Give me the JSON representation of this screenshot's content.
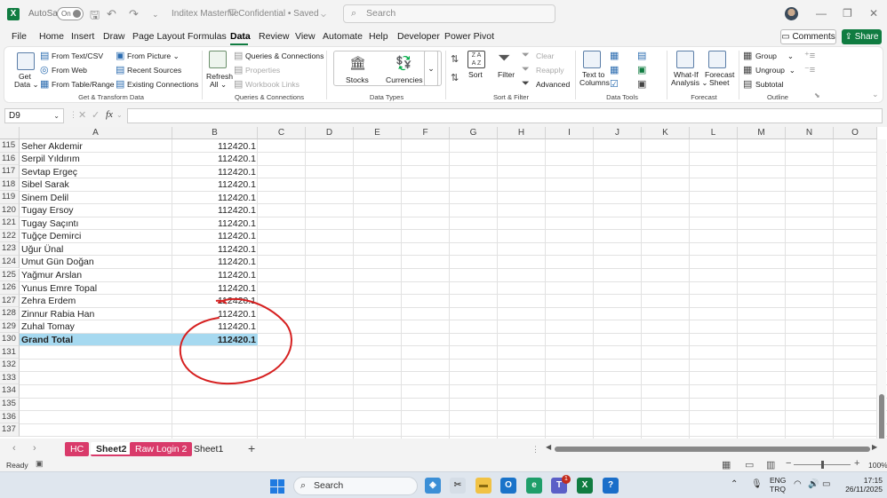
{
  "titlebar": {
    "autosave_label": "AutoSave",
    "autosave_state": "On",
    "doc_title": "Inditex Masterfile",
    "sensitivity": "Confidential",
    "save_state": "Saved",
    "search_placeholder": "Search"
  },
  "menu": [
    "File",
    "Home",
    "Insert",
    "Draw",
    "Page Layout",
    "Formulas",
    "Data",
    "Review",
    "View",
    "Automate",
    "Help",
    "Developer",
    "Power Pivot"
  ],
  "menu_active": "Data",
  "comments_label": "Comments",
  "share_label": "Share",
  "ribbon": {
    "get_data": "Get Data",
    "get_data_line1": "Get",
    "get_data_line2": "Data",
    "from_text_csv": "From Text/CSV",
    "from_web": "From Web",
    "from_table_range": "From Table/Range",
    "from_picture": "From Picture",
    "recent_sources": "Recent Sources",
    "existing_connections": "Existing Connections",
    "group_get_transform": "Get & Transform Data",
    "refresh_all_line1": "Refresh",
    "refresh_all_line2": "All",
    "queries_connections": "Queries & Connections",
    "properties": "Properties",
    "workbook_links": "Workbook Links",
    "group_queries": "Queries & Connections",
    "stocks": "Stocks",
    "currencies": "Currencies",
    "group_data_types": "Data Types",
    "sort": "Sort",
    "filter": "Filter",
    "clear": "Clear",
    "reapply": "Reapply",
    "advanced": "Advanced",
    "group_sort_filter": "Sort & Filter",
    "text_to_columns_line1": "Text to",
    "text_to_columns_line2": "Columns",
    "group_data_tools": "Data Tools",
    "what_if_line1": "What-If",
    "what_if_line2": "Analysis",
    "forecast_sheet_line1": "Forecast",
    "forecast_sheet_line2": "Sheet",
    "group_forecast": "Forecast",
    "group": "Group",
    "ungroup": "Ungroup",
    "subtotal": "Subtotal",
    "group_outline": "Outline"
  },
  "formula_bar": {
    "name_box": "D9",
    "fx": "fx",
    "formula": ""
  },
  "columns": [
    "A",
    "B",
    "C",
    "D",
    "E",
    "F",
    "G",
    "H",
    "I",
    "J",
    "K",
    "L",
    "M",
    "N",
    "O"
  ],
  "rows": [
    {
      "num": "115",
      "a": "Seher Akdemir",
      "b": "112420.1"
    },
    {
      "num": "116",
      "a": "Serpil Yıldırım",
      "b": "112420.1"
    },
    {
      "num": "117",
      "a": "Sevtap Ergeç",
      "b": "112420.1"
    },
    {
      "num": "118",
      "a": "Sibel Sarak",
      "b": "112420.1"
    },
    {
      "num": "119",
      "a": "Sinem Delil",
      "b": "112420.1"
    },
    {
      "num": "120",
      "a": "Tugay Ersoy",
      "b": "112420.1"
    },
    {
      "num": "121",
      "a": "Tugay Saçıntı",
      "b": "112420.1"
    },
    {
      "num": "122",
      "a": "Tuğçe Demirci",
      "b": "112420.1"
    },
    {
      "num": "123",
      "a": "Uğur Ünal",
      "b": "112420.1"
    },
    {
      "num": "124",
      "a": "Umut Gün Doğan",
      "b": "112420.1"
    },
    {
      "num": "125",
      "a": "Yağmur Arslan",
      "b": "112420.1"
    },
    {
      "num": "126",
      "a": "Yunus Emre Topal",
      "b": "112420.1"
    },
    {
      "num": "127",
      "a": "Zehra Erdem",
      "b": "112420.1"
    },
    {
      "num": "128",
      "a": "Zinnur Rabia Han",
      "b": "112420.1"
    },
    {
      "num": "129",
      "a": "Zuhal Tomay",
      "b": "112420.1"
    },
    {
      "num": "130",
      "a": "Grand Total",
      "b": "112420.1"
    },
    {
      "num": "131",
      "a": "",
      "b": ""
    },
    {
      "num": "132",
      "a": "",
      "b": ""
    },
    {
      "num": "133",
      "a": "",
      "b": ""
    },
    {
      "num": "134",
      "a": "",
      "b": ""
    },
    {
      "num": "135",
      "a": "",
      "b": ""
    },
    {
      "num": "136",
      "a": "",
      "b": ""
    },
    {
      "num": "137",
      "a": "",
      "b": ""
    }
  ],
  "annotation_color": "#d62020",
  "sheet_tabs": [
    {
      "label": "HC",
      "style": "pink"
    },
    {
      "label": "Sheet2",
      "style": "active"
    },
    {
      "label": "Raw Login 2",
      "style": "pink"
    },
    {
      "label": "Sheet1",
      "style": "plain"
    }
  ],
  "status": {
    "ready": "Ready",
    "zoom": "100%",
    "zoom_fraction": 0.5
  },
  "taskbar": {
    "search": "Search",
    "lang_line1": "ENG",
    "lang_line2": "TRQ",
    "time": "17:15",
    "date": "26/11/2025",
    "teams_badge": "1"
  }
}
